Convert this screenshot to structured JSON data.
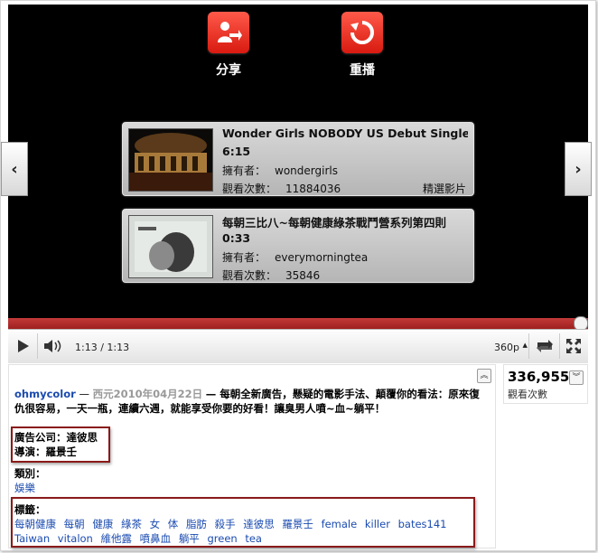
{
  "player": {
    "actions": [
      {
        "label": "分享",
        "icon": "share-icon"
      },
      {
        "label": "重播",
        "icon": "replay-icon"
      }
    ],
    "related": [
      {
        "title": "Wonder Girls NOBODY US Debut Single",
        "duration": "6:15",
        "owner_label": "擁有者：",
        "owner": "wondergirls",
        "views_label": "觀看次數：",
        "views": "11884036",
        "badge": "精選影片"
      },
      {
        "title": "每朝三比八~每朝健康綠茶戰鬥營系列第四則",
        "duration": "0:33",
        "owner_label": "擁有者：",
        "owner": "everymorningtea",
        "views_label": "觀看次數：",
        "views": "35846",
        "badge": ""
      }
    ],
    "controls": {
      "time": "1:13 / 1:13",
      "quality": "360p",
      "progress_fraction": 1.0
    },
    "nav_left": "‹",
    "nav_right": "›"
  },
  "info": {
    "author": "ohmycolor",
    "dash": "—",
    "date": "西元2010年04月22日",
    "description": "— 每朝全新廣告，懸疑的電影手法、顛覆你的看法：原來復仇很容易，一天一瓶，連續六週，就能享受你要的好看！讓臭男人噴~血~躺平！",
    "credits": [
      "廣告公司：達彼思",
      "導演：羅景壬"
    ],
    "category_label": "類別：",
    "category": "娛樂",
    "tags_label": "標籤：",
    "tags": [
      "每朝健康",
      "每朝",
      "健康",
      "綠茶",
      "女",
      "体",
      "脂肪",
      "殺手",
      "達彼思",
      "羅景壬",
      "female",
      "killer",
      "bates141",
      "Taiwan",
      "vitalon",
      "維他露",
      "噴鼻血",
      "躺平",
      "green",
      "tea"
    ],
    "view_count": "336,955",
    "view_count_label": "觀看次數"
  },
  "colors": {
    "progress": "#b02a2a",
    "link": "#1a4bb0",
    "highlight_box": "#8b1a1a",
    "action_icon": "#e0261b"
  }
}
